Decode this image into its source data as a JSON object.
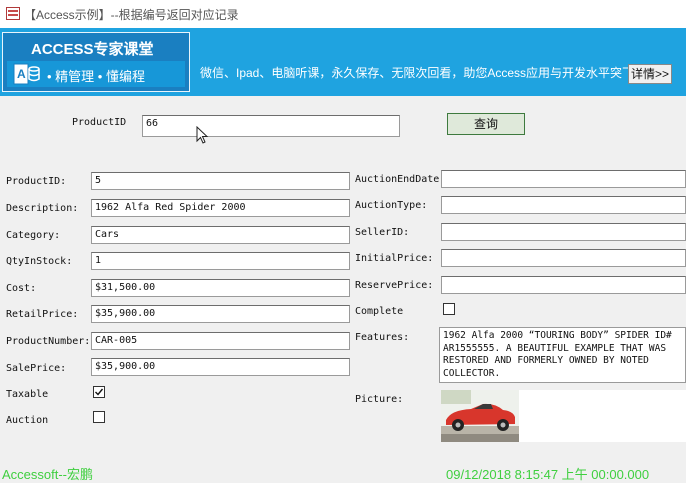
{
  "window": {
    "title": "【Access示例】--根据编号返回对应记录",
    "icon": "form-icon"
  },
  "banner": {
    "brand": "ACCESS专家课堂",
    "items": "•  精管理  •  懂编程",
    "slogan": "微信、Ipad、电脑听课，永久保存、无限次回看，助您Access应用与开发水平突飞猛进！",
    "detail_button": "详情>>",
    "colors": {
      "background": "#1fa3e0",
      "logo": "#1a7fc1"
    }
  },
  "search": {
    "label": "ProductID",
    "value": "66",
    "button": "查询"
  },
  "left_fields": [
    {
      "label": "ProductID:",
      "value": "5"
    },
    {
      "label": "Description:",
      "value": "1962 Alfa Red Spider 2000"
    },
    {
      "label": "Category:",
      "value": "Cars"
    },
    {
      "label": "QtyInStock:",
      "value": "1"
    },
    {
      "label": "Cost:",
      "value": "$31,500.00"
    },
    {
      "label": "RetailPrice:",
      "value": "$35,900.00"
    },
    {
      "label": "ProductNumber:",
      "value": "CAR-005"
    },
    {
      "label": "SalePrice:",
      "value": "$35,900.00"
    }
  ],
  "taxable": {
    "label": "Taxable",
    "checked": true
  },
  "auction": {
    "label": "Auction",
    "checked": false
  },
  "right_fields": [
    {
      "label": "AuctionEndDate:",
      "value": ""
    },
    {
      "label": "AuctionType:",
      "value": ""
    },
    {
      "label": "SellerID:",
      "value": ""
    },
    {
      "label": "InitialPrice:",
      "value": ""
    },
    {
      "label": "ReservePrice:",
      "value": ""
    }
  ],
  "complete": {
    "label": "Complete",
    "checked": false
  },
  "features": {
    "label": "Features:",
    "text": "1962 Alfa  2000 “TOURING BODY” SPIDER ID# AR1555555. A BEAUTIFUL EXAMPLE THAT WAS RESTORED AND FORMERLY OWNED BY NOTED COLLECTOR."
  },
  "picture": {
    "label": "Picture:"
  },
  "status": {
    "left": "Accessoft--宏鹏",
    "right": "09/12/2018 8:15:47 上午 00:00.000",
    "color": "#3fcf3f"
  }
}
